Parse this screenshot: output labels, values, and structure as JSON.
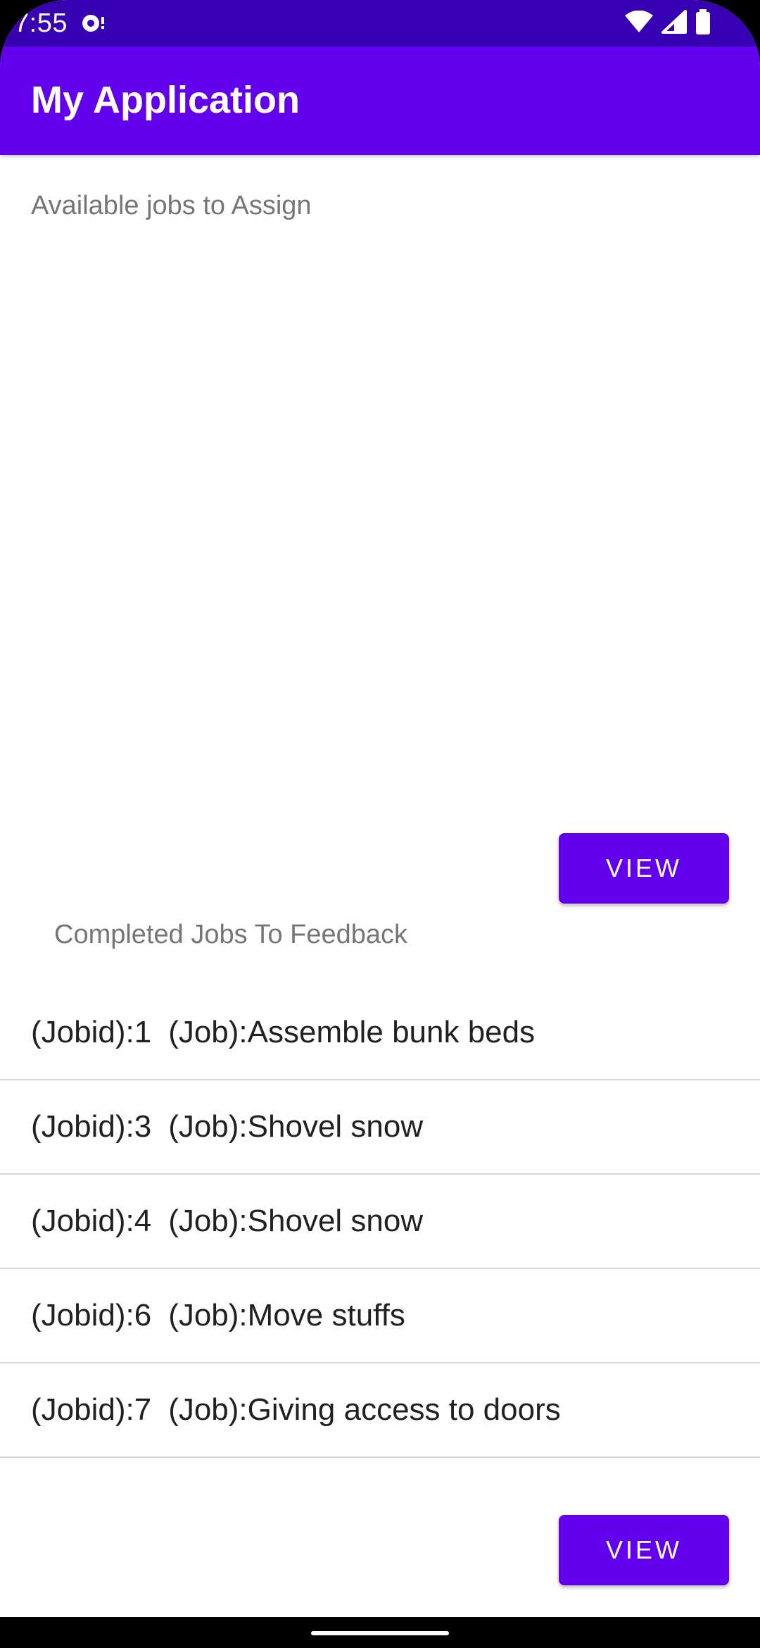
{
  "status_bar": {
    "time": "7:55",
    "icons": [
      "notification-icon",
      "wifi-icon",
      "cellular-signal-icon",
      "battery-icon"
    ]
  },
  "app_bar": {
    "title": "My Application"
  },
  "available_section": {
    "label": "Available jobs to Assign",
    "view_button_label": "VIEW"
  },
  "completed_section": {
    "label": "Completed Jobs To Feedback",
    "view_button_label": "VIEW",
    "jobs": [
      {
        "id": "(Jobid):1",
        "job": "(Job):Assemble bunk beds"
      },
      {
        "id": "(Jobid):3",
        "job": "(Job):Shovel snow"
      },
      {
        "id": "(Jobid):4",
        "job": "(Job):Shovel snow"
      },
      {
        "id": "(Jobid):6",
        "job": "(Job):Move stuffs"
      },
      {
        "id": "(Jobid):7",
        "job": "(Job):Giving access to doors"
      }
    ]
  },
  "colors": {
    "status_bar": "#3700b3",
    "primary": "#6200ee",
    "label_text": "#757575",
    "list_text": "#212121",
    "divider": "#d9d9d9"
  }
}
